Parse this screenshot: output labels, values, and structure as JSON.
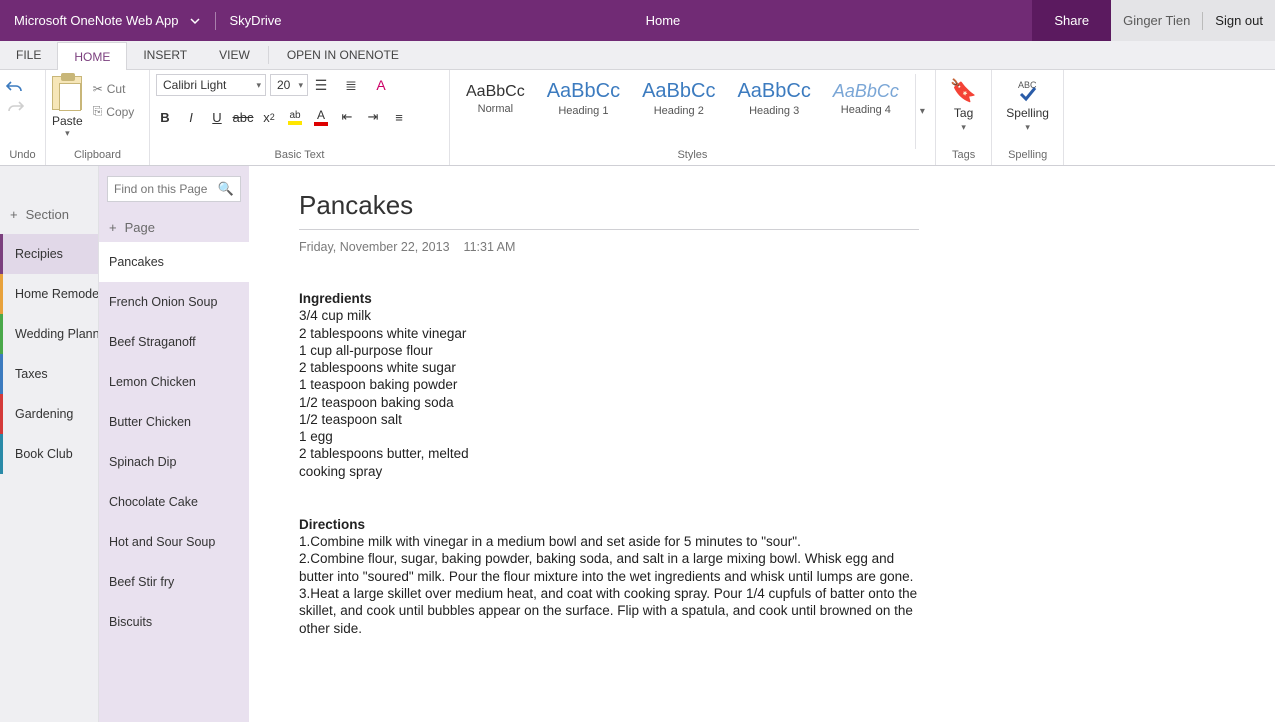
{
  "titlebar": {
    "app_name": "Microsoft OneNote Web App",
    "service": "SkyDrive",
    "center": "Home",
    "share": "Share",
    "user": "Ginger Tien",
    "signout": "Sign out"
  },
  "tabs": {
    "file": "FILE",
    "home": "HOME",
    "insert": "INSERT",
    "view": "VIEW",
    "open_in": "OPEN IN ONENOTE"
  },
  "ribbon": {
    "undo_label": "Undo",
    "paste": "Paste",
    "cut": "Cut",
    "copy": "Copy",
    "clipboard_label": "Clipboard",
    "font_name": "Calibri Light",
    "font_size": "20",
    "basic_text_label": "Basic Text",
    "styles_label": "Styles",
    "tag": "Tag",
    "tags_label": "Tags",
    "spelling": "Spelling",
    "spelling_label": "Spelling",
    "styles": [
      {
        "sample": "AaBbCc",
        "name": "Normal",
        "cls": ""
      },
      {
        "sample": "AaBbCc",
        "name": "Heading 1",
        "cls": "h"
      },
      {
        "sample": "AaBbCc",
        "name": "Heading 2",
        "cls": "h"
      },
      {
        "sample": "AaBbCc",
        "name": "Heading 3",
        "cls": "h"
      },
      {
        "sample": "AaBbCc",
        "name": "Heading 4",
        "cls": "hi"
      }
    ]
  },
  "sections": {
    "add_label": "Section",
    "items": [
      {
        "label": "Recipies",
        "color": "active"
      },
      {
        "label": "Home Remodel",
        "color": "c-orange"
      },
      {
        "label": "Wedding Planning",
        "color": "c-green"
      },
      {
        "label": "Taxes",
        "color": "c-blue"
      },
      {
        "label": "Gardening",
        "color": "c-red"
      },
      {
        "label": "Book Club",
        "color": "c-teal"
      }
    ]
  },
  "pages": {
    "search_placeholder": "Find on this Page",
    "add_label": "Page",
    "items": [
      "Pancakes",
      "French Onion Soup",
      "Beef Straganoff",
      "Lemon Chicken",
      "Butter Chicken",
      "Spinach Dip",
      "Chocolate Cake",
      "Hot and Sour Soup",
      "Beef Stir fry",
      "Biscuits"
    ]
  },
  "note": {
    "title": "Pancakes",
    "date": "Friday, November 22, 2013",
    "time": "11:31 AM",
    "ingredients_heading": "Ingredients",
    "ingredients": [
      "3/4 cup milk",
      "2 tablespoons white vinegar",
      "1 cup all-purpose flour",
      "2 tablespoons white sugar",
      "1 teaspoon baking powder",
      "1/2 teaspoon baking soda",
      "1/2 teaspoon salt",
      "1 egg",
      "2 tablespoons butter, melted",
      "cooking spray"
    ],
    "directions_heading": "Directions",
    "directions": [
      "1.Combine milk with vinegar in a medium bowl and set aside for 5 minutes to \"sour\".",
      "2.Combine flour, sugar, baking powder, baking soda, and salt in a large mixing bowl. Whisk egg and butter into \"soured\" milk. Pour the flour mixture into the wet ingredients and whisk until lumps are gone.",
      "3.Heat a large skillet over medium heat, and coat with cooking spray. Pour 1/4 cupfuls of batter onto the skillet, and cook until bubbles appear on the surface. Flip with a spatula, and cook until browned on the other side."
    ]
  }
}
